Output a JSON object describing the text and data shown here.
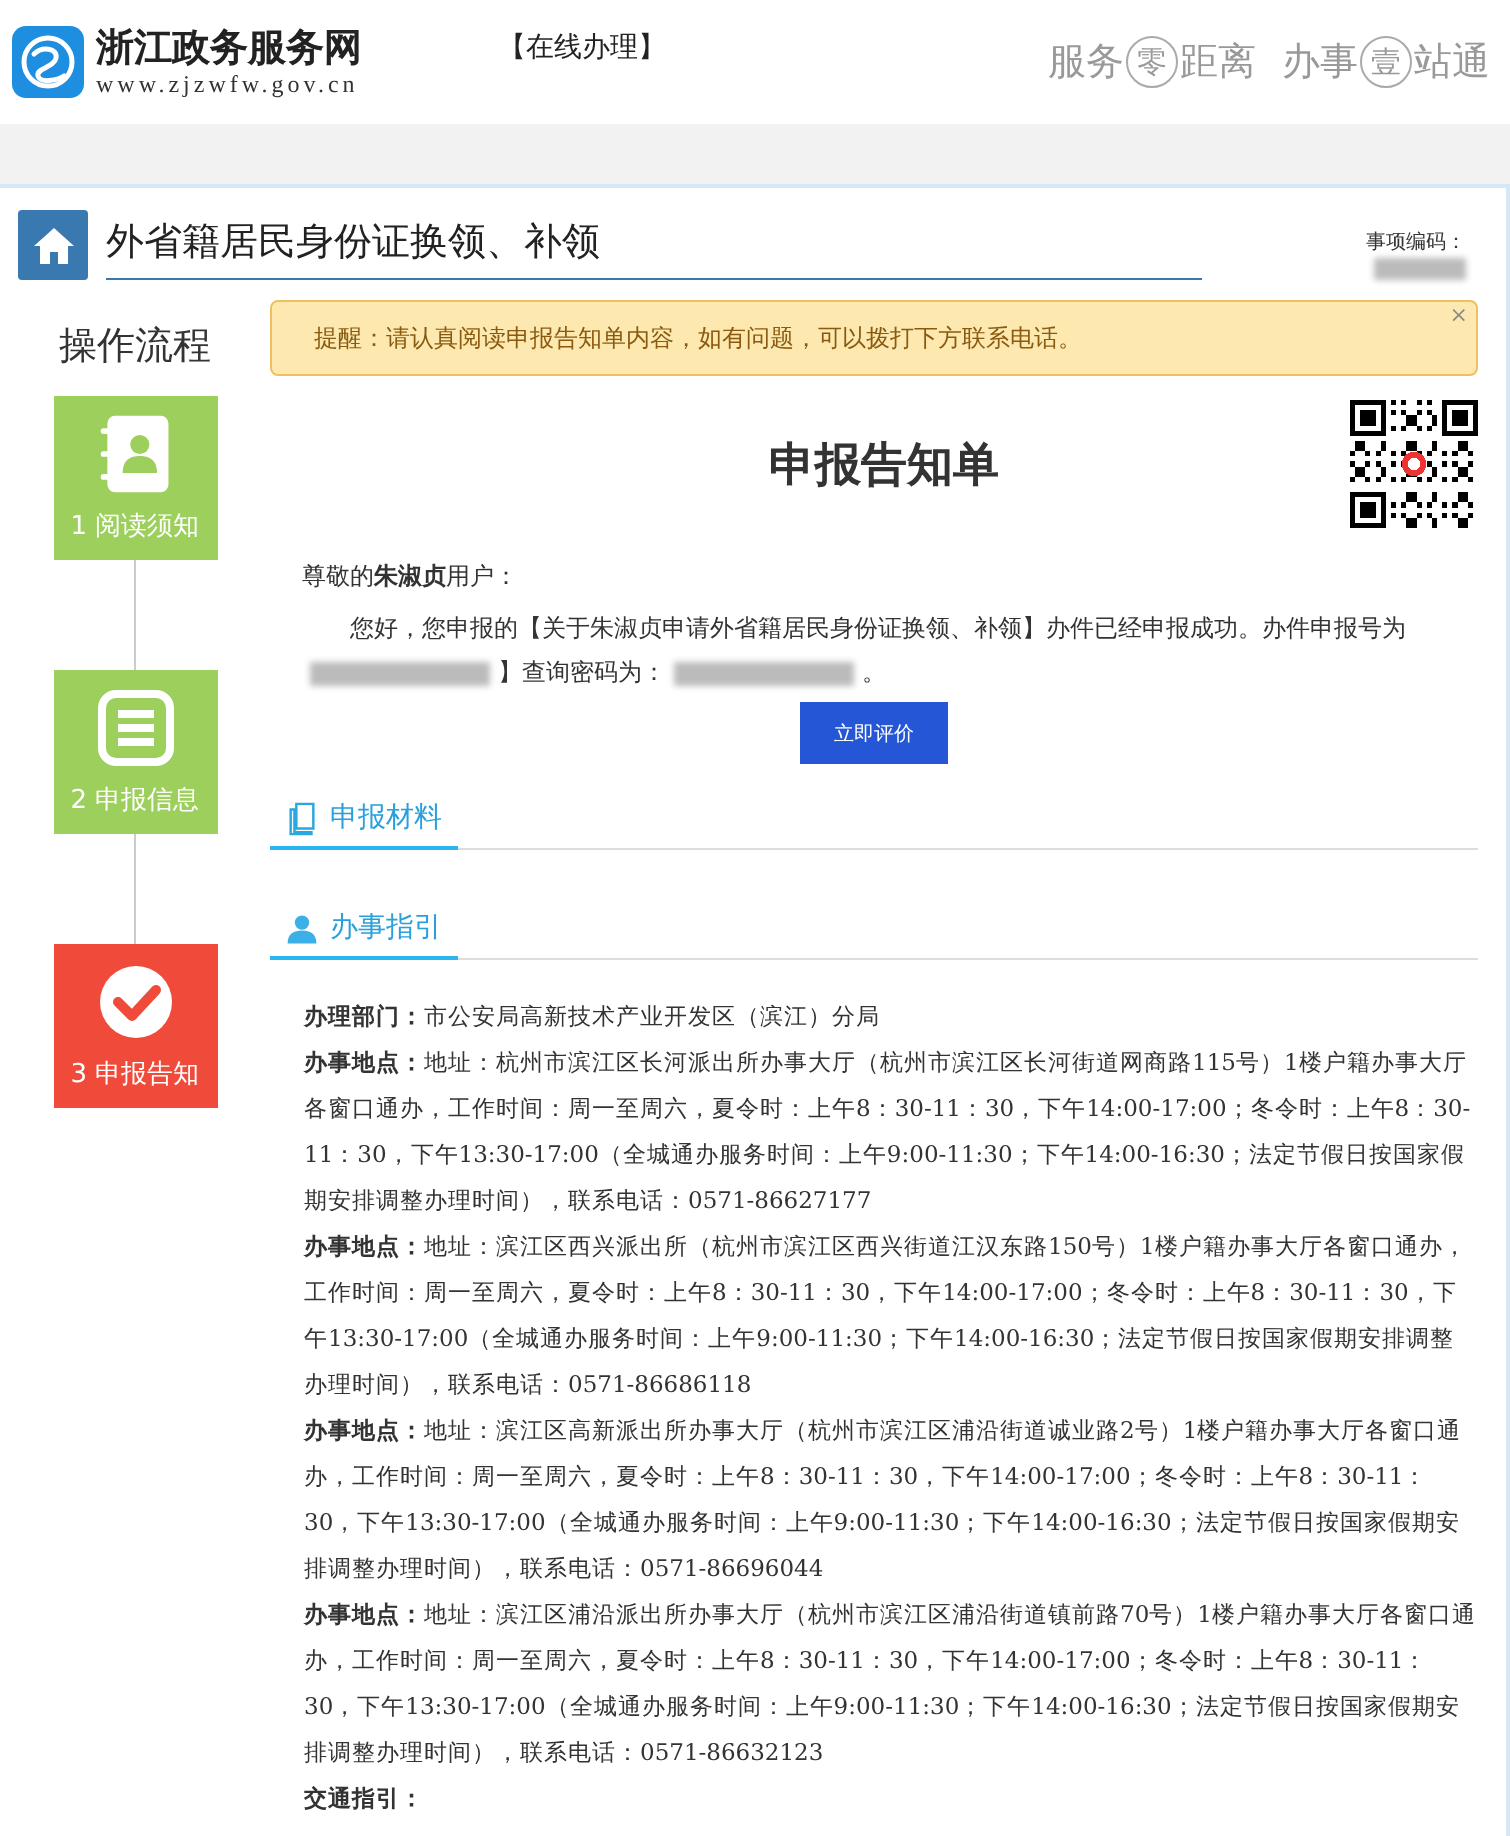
{
  "header": {
    "site_name": "浙江政务服务网",
    "site_url": "www.zjzwfw.gov.cn",
    "section": "【在线办理】",
    "slogan": [
      {
        "text": "服务",
        "circled": false
      },
      {
        "text": "零",
        "circled": true
      },
      {
        "text": "距离",
        "circled": false
      },
      {
        "text": "办事",
        "circled": false
      },
      {
        "text": "壹",
        "circled": true
      },
      {
        "text": "站通",
        "circled": false
      }
    ]
  },
  "page_title": "外省籍居民身份证换领、补领",
  "item_code": {
    "label": "事项编码："
  },
  "sidebar": {
    "title": "操作流程",
    "steps": [
      {
        "label": "1 阅读须知",
        "kind": "contacts",
        "selected": false
      },
      {
        "label": "2 申报信息",
        "kind": "form",
        "selected": false
      },
      {
        "label": "3 申报告知",
        "kind": "check",
        "selected": true
      }
    ]
  },
  "alert": {
    "text": "提醒：请认真阅读申报告知单内容，如有问题，可以拨打下方联系电话。",
    "close": "×"
  },
  "notice": {
    "title": "申报告知单",
    "greeting": "尊敬的**朱淑贞**用户：",
    "body": [
      {
        "kind": "text",
        "text": "您好，您申报的【关于朱淑贞申请外省籍居民身份证换领、补领】办件已经申报成功。办件申报号为"
      },
      {
        "kind": "redacted"
      },
      {
        "kind": "text",
        "text": "】查询密码为："
      },
      {
        "kind": "redacted"
      },
      {
        "kind": "text",
        "text": "。"
      }
    ],
    "button": "立即评价"
  },
  "sections": [
    {
      "title": "申报材料",
      "kind": "files"
    },
    {
      "title": "办事指引",
      "kind": "person"
    }
  ],
  "guide": [
    "**办理部门：**市公安局高新技术产业开发区（滨江）分局",
    "**办事地点：**地址：杭州市滨江区长河派出所办事大厅（杭州市滨江区长河街道网商路115号）1楼户籍办事大厅各窗口通办，工作时间：周一至周六，夏令时：上午8：30-11：30，下午14:00-17:00；冬令时：上午8：30-11：30，下午13:30-17:00（全城通办服务时间：上午9:00-11:30；下午14:00-16:30；法定节假日按国家假期安排调整办理时间），联系电话：0571-86627177",
    "**办事地点：**地址：滨江区西兴派出所（杭州市滨江区西兴街道江汉东路150号）1楼户籍办事大厅各窗口通办，工作时间：周一至周六，夏令时：上午8：30-11：30，下午14:00-17:00；冬令时：上午8：30-11：30，下午13:30-17:00（全城通办服务时间：上午9:00-11:30；下午14:00-16:30；法定节假日按国家假期安排调整办理时间），联系电话：0571-86686118",
    "**办事地点：**地址：滨江区高新派出所办事大厅（杭州市滨江区浦沿街道诚业路2号）1楼户籍办事大厅各窗口通办，工作时间：周一至周六，夏令时：上午8：30-11：30，下午14:00-17:00；冬令时：上午8：30-11：30，下午13:30-17:00（全城通办服务时间：上午9:00-11:30；下午14:00-16:30；法定节假日按国家假期安排调整办理时间），联系电话：0571-86696044",
    "**办事地点：**地址：滨江区浦沿派出所办事大厅（杭州市滨江区浦沿街道镇前路70号）1楼户籍办事大厅各窗口通办，工作时间：周一至周六，夏令时：上午8：30-11：30，下午14:00-17:00；冬令时：上午8：30-11：30，下午13:30-17:00（全城通办服务时间：上午9:00-11:30；下午14:00-16:30；法定节假日按国家假期安排调整办理时间），联系电话：0571-86632123",
    "**交通指引：**"
  ]
}
